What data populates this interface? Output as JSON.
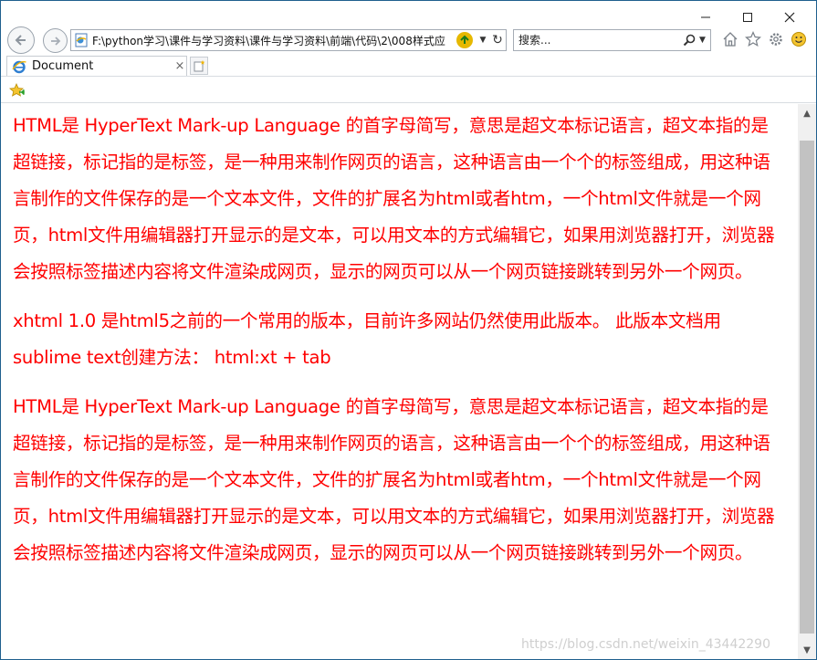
{
  "window": {
    "controls": {
      "minimize": "–",
      "maximize": "□",
      "close": "✕"
    }
  },
  "nav": {
    "address_url": "F:\\python学习\\课件与学习资料\\课件与学习资料\\前端\\代码\\2\\008样式应",
    "search_placeholder": "搜索..."
  },
  "tab": {
    "title": "Document",
    "close": "×"
  },
  "content": {
    "paragraphs": [
      "HTML是 HyperText Mark-up Language 的首字母简写，意思是超文本标记语言，超文本指的是超链接，标记指的是标签，是一种用来制作网页的语言，这种语言由一个个的标签组成，用这种语言制作的文件保存的是一个文本文件，文件的扩展名为html或者htm，一个html文件就是一个网页，html文件用编辑器打开显示的是文本，可以用文本的方式编辑它，如果用浏览器打开，浏览器会按照标签描述内容将文件渲染成网页，显示的网页可以从一个网页链接跳转到另外一个网页。",
      "xhtml 1.0 是html5之前的一个常用的版本，目前许多网站仍然使用此版本。 此版本文档用sublime text创建方法： html:xt + tab",
      "HTML是 HyperText Mark-up Language 的首字母简写，意思是超文本标记语言，超文本指的是超链接，标记指的是标签，是一种用来制作网页的语言，这种语言由一个个的标签组成，用这种语言制作的文件保存的是一个文本文件，文件的扩展名为html或者htm，一个html文件就是一个网页，html文件用编辑器打开显示的是文本，可以用文本的方式编辑它，如果用浏览器打开，浏览器会按照标签描述内容将文件渲染成网页，显示的网页可以从一个网页链接跳转到另外一个网页。"
    ],
    "text_color": "#ff0000",
    "watermark": "https://blog.csdn.net/weixin_43442290"
  },
  "icons": {
    "back": "back-arrow-icon",
    "forward": "forward-arrow-icon",
    "refresh": "refresh-icon",
    "search": "search-icon",
    "home": "home-icon",
    "favorites": "star-icon",
    "settings": "gear-icon",
    "feedback": "smiley-icon"
  }
}
